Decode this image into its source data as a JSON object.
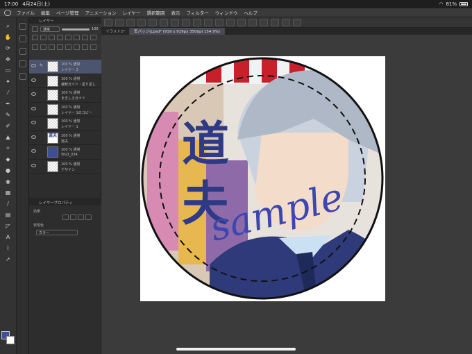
{
  "status": {
    "time": "17:00",
    "date": "4月24日(土)",
    "battery": "81%"
  },
  "menu": [
    "ファイル",
    "編集",
    "ページ管理",
    "アニメーション",
    "レイヤー",
    "選択範囲",
    "表示",
    "フィルター",
    "ウィンドウ",
    "ヘルプ"
  ],
  "tabs": [
    {
      "label": "イラスト2*"
    },
    {
      "label": "缶バッジ(Lpsd* (919 x 919px 350dpi 154.9%)"
    }
  ],
  "layer_panel": {
    "title": "レイヤー",
    "blend_mode": "通常",
    "opacity": "100",
    "layers": [
      {
        "opacity": "100 % 通常",
        "name": "レイヤー 2",
        "thumb": "blank"
      },
      {
        "opacity": "100 % 通常",
        "name": "裁断ガイド・塗り足し",
        "thumb": "blank"
      },
      {
        "opacity": "100 % 通常",
        "name": "まきしろガイド",
        "thumb": "blank"
      },
      {
        "opacity": "100 % 通常",
        "name": "レイヤー 1のコピー",
        "thumb": "blank"
      },
      {
        "opacity": "100 % 通常",
        "name": "レイヤー 1",
        "thumb": "blank"
      },
      {
        "opacity": "100 % 通常",
        "name": "道夫",
        "thumb": "text",
        "thumb_text": "道夫"
      },
      {
        "opacity": "100 % 通常",
        "name": "SIG3_034",
        "thumb": "image"
      },
      {
        "opacity": "100 % 通常",
        "name": "デザイン",
        "thumb": "blank"
      }
    ]
  },
  "properties_panel": {
    "title": "レイヤープロパティ",
    "effect_label": "効果",
    "expression_label": "表現色",
    "expression_value": "カラー"
  },
  "artwork": {
    "kanji_top": "道",
    "kanji_bottom": "夫",
    "watermark": "sample"
  },
  "colors": {
    "accent": "#4050a0",
    "selected_layer": "#4d556e"
  }
}
